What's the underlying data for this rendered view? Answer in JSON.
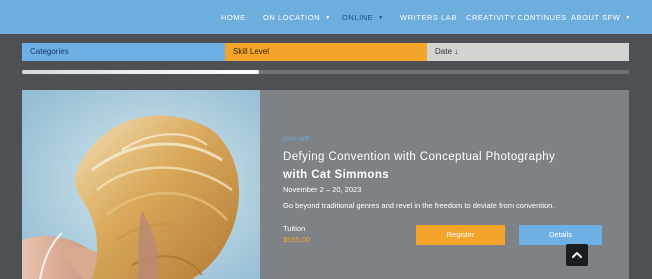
{
  "nav": {
    "items": [
      {
        "label": "HOME"
      },
      {
        "label": "ON LOCATION",
        "caret": "▼"
      },
      {
        "label": "ONLINE",
        "caret": "▼"
      },
      {
        "label": "WRITERS LAB"
      },
      {
        "label": "CREATIVITY CONTINUES"
      },
      {
        "label": "ABOUT SFW",
        "caret": "▼"
      }
    ],
    "active_item": "ONLINE"
  },
  "filters": {
    "categories": "Categories",
    "skill_level": "Skill Level",
    "date": "Date ↓"
  },
  "scroll_progress": {
    "fraction": 0.39
  },
  "course": {
    "kicker": "ONLINE",
    "title": "Defying Convention with Conceptual Photography",
    "instructor": "with Cat Simmons",
    "dates": "November 2 – 20, 2023",
    "description": "Go beyond traditional genres and revel in the freedom to deviate from convention.",
    "tuition_label": "Tuition",
    "tuition_price": "$595.00",
    "register_label": "Register",
    "details_label": "Details",
    "image_subject": "woman-with-blonde-hair-photo"
  },
  "back_to_top": {
    "icon": "chevron-up-icon"
  },
  "colors": {
    "nav_bg": "#6eaedf",
    "nav_active": "#1c4f86",
    "page_bg": "#4d5054",
    "card_bg": "#7e8286",
    "accent_blue": "#6fb0e4",
    "accent_orange": "#f3a52b",
    "date_filter_bg": "#d3d3d3"
  }
}
